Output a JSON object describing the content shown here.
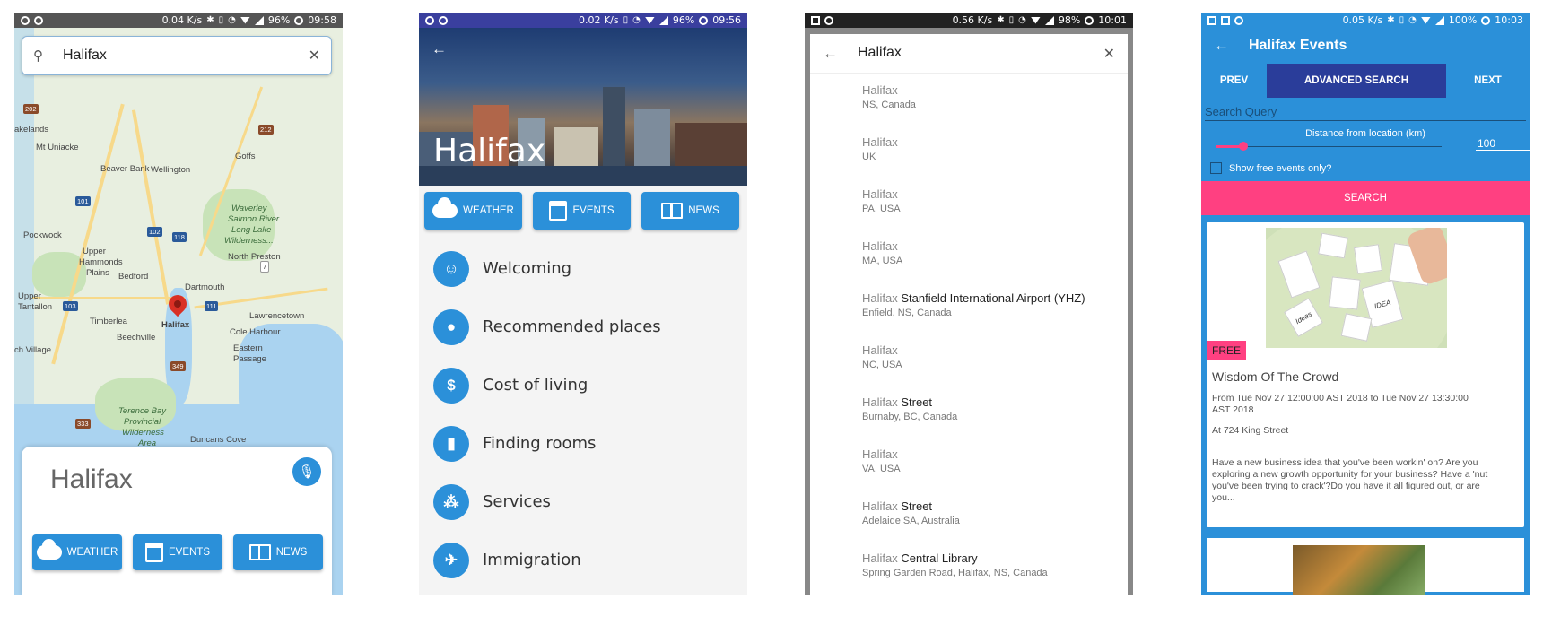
{
  "screen1": {
    "status": {
      "speed": "0.04 K/s",
      "battery": "96%",
      "time": "09:58"
    },
    "search_value": "Halifax",
    "map_labels": [
      "Halifax",
      "Mt Uniacke",
      "Beaver Bank",
      "Wellington",
      "Goffs",
      "Waverley",
      "Salmon River",
      "Long Lake",
      "Wilderness...",
      "Pockwock",
      "Upper",
      "Hammonds",
      "Plains",
      "Bedford",
      "North Preston",
      "Dartmouth",
      "Upper",
      "Tantallon",
      "Timberlea",
      "Beechville",
      "Lawrencetown",
      "Cole Harbour",
      "Eastern",
      "Passage",
      "ch Village",
      "Terence Bay",
      "Provincial",
      "Wilderness",
      "Area",
      "Duncans Cove",
      "akelands"
    ],
    "route_numbers": [
      "202",
      "212",
      "101",
      "102",
      "118",
      "7",
      "103",
      "111",
      "349",
      "333"
    ],
    "city_title": "Halifax",
    "buttons": {
      "weather": "WEATHER",
      "events": "EVENTS",
      "news": "NEWS"
    }
  },
  "screen2": {
    "status": {
      "speed": "0.02 K/s",
      "battery": "96%",
      "time": "09:56"
    },
    "title": "Halifax",
    "buttons": {
      "weather": "WEATHER",
      "events": "EVENTS",
      "news": "NEWS"
    },
    "menu": [
      {
        "label": "Welcoming",
        "icon": "accessibility-icon"
      },
      {
        "label": "Recommended places",
        "icon": "location-pin-icon"
      },
      {
        "label": "Cost of living",
        "icon": "dollar-icon"
      },
      {
        "label": "Finding rooms",
        "icon": "door-icon"
      },
      {
        "label": "Services",
        "icon": "services-icon"
      },
      {
        "label": "Immigration",
        "icon": "airplane-icon"
      }
    ]
  },
  "screen3": {
    "status": {
      "speed": "0.56 K/s",
      "battery": "98%",
      "time": "10:01"
    },
    "search_value": "Halifax",
    "results": [
      {
        "match": "Halifax",
        "rest": "",
        "sub": "NS, Canada"
      },
      {
        "match": "Halifax",
        "rest": "",
        "sub": "UK"
      },
      {
        "match": "Halifax",
        "rest": "",
        "sub": "PA, USA"
      },
      {
        "match": "Halifax",
        "rest": "",
        "sub": "MA, USA"
      },
      {
        "match": "Halifax",
        "rest": " Stanfield International Airport (YHZ)",
        "sub": "Enfield, NS, Canada"
      },
      {
        "match": "Halifax",
        "rest": "",
        "sub": "NC, USA"
      },
      {
        "match": "Halifax",
        "rest": " Street",
        "sub": "Burnaby, BC, Canada"
      },
      {
        "match": "Halifax",
        "rest": "",
        "sub": "VA, USA"
      },
      {
        "match": "Halifax",
        "rest": " Street",
        "sub": "Adelaide SA, Australia"
      },
      {
        "match": "Halifax",
        "rest": " Central Library",
        "sub": "Spring Garden Road, Halifax, NS, Canada"
      }
    ]
  },
  "screen4": {
    "status": {
      "speed": "0.05 K/s",
      "battery": "100%",
      "time": "10:03"
    },
    "title": "Halifax Events",
    "tabs": {
      "prev": "PREV",
      "advanced": "ADVANCED SEARCH",
      "next": "NEXT"
    },
    "search_query_placeholder": "Search Query",
    "distance_label": "Distance from location (km)",
    "distance_value": "100",
    "free_only_label": "Show free events only?",
    "free_only_checked": false,
    "search_button": "SEARCH",
    "event": {
      "badge": "FREE",
      "title": "Wisdom Of The Crowd",
      "date": "From Tue Nov 27 12:00:00 AST 2018 to Tue Nov 27 13:30:00 AST 2018",
      "location": "At 724 King Street",
      "description": "Have a new business idea that you've been workin' on? Are you exploring a new growth opportunity for your business? Have a 'nut you've been trying to crack'?Do you have it all figured out, or are you..."
    },
    "image_notes": [
      "IDEA",
      "Ideas"
    ]
  },
  "colors": {
    "accent_blue": "#2b90d9",
    "pink": "#ff4081",
    "indigo_status": "#3a3f9e"
  }
}
